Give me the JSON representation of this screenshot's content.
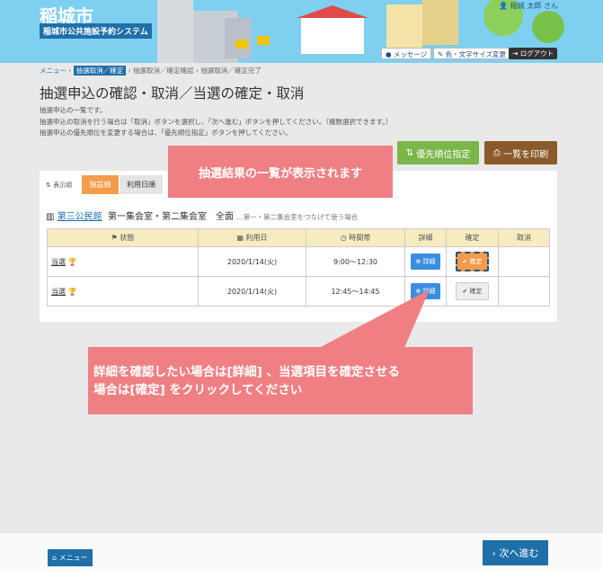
{
  "header": {
    "city": "稲城市",
    "system": "稲城市公共施設予約システム",
    "user": "稲城 太郎 さん",
    "message": "メッセージ",
    "font": "色・文字サイズ変更",
    "logout": "ログアウト"
  },
  "breadcrumb": {
    "menu": "メニュー",
    "s1": "抽選取消／確定",
    "s2": "抽選取消／確定確認",
    "s3": "抽選取消／確定完了"
  },
  "page": {
    "title": "抽選申込の確認・取消／当選の確定・取消",
    "desc1": "抽選申込の一覧です。",
    "desc2": "抽選申込の取消を行う場合は「取消」ボタンを選択し、「次へ進む」ボタンを押してください。（複数選択できます。）",
    "desc3": "抽選申込の優先順位を変更する場合は、「優先順位指定」ボタンを押してください。"
  },
  "buttons": {
    "priority": "優先順位指定",
    "print": "一覧を印刷"
  },
  "sort": {
    "label": "表示順",
    "tab1": "施設順",
    "tab2": "利用日順"
  },
  "facility": {
    "name": "第三公民館",
    "room": "第一集会室・第二集会室　全面",
    "note": "…第一・第二集会室をつなげて使う場合"
  },
  "table": {
    "headers": [
      "状態",
      "利用日",
      "時間帯",
      "詳細",
      "確定",
      "取消"
    ],
    "rows": [
      {
        "status": "当選",
        "date": "2020/1/14(火)",
        "time": "9:00～12:30",
        "detail": "詳細",
        "confirm": "確定"
      },
      {
        "status": "当選",
        "date": "2020/1/14(火)",
        "time": "12:45～14:45",
        "detail": "詳細",
        "confirm": "確定"
      }
    ]
  },
  "callouts": {
    "c1": "抽選結果の一覧が表示されます",
    "c2a": "詳細を確認したい場合は[詳細] 、当選項目を確定させる",
    "c2b": "場合は[確定] をクリックしてください"
  },
  "footer": {
    "menu": "メニュー",
    "next": "次へ進む"
  }
}
